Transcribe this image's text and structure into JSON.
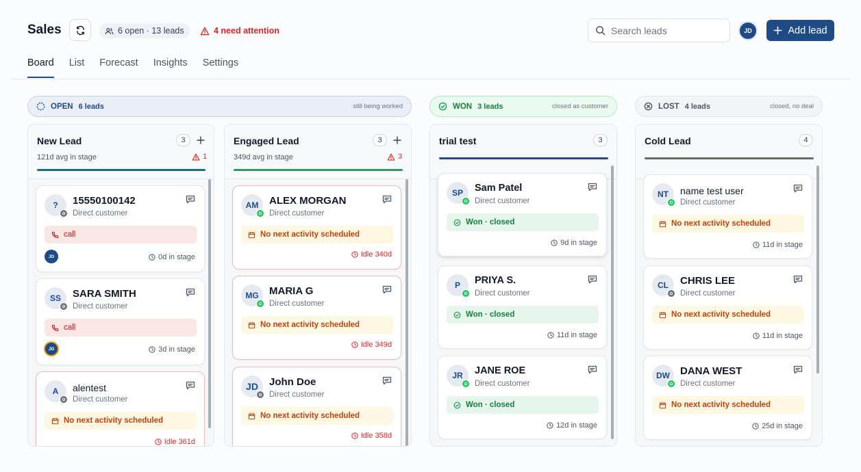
{
  "header": {
    "title": "Sales",
    "lead_count": "6 open · 13 leads",
    "attention": "4 need attention",
    "search_placeholder": "Search leads",
    "user_initials": "JD",
    "add_label": "Add lead"
  },
  "tabs": [
    "Board",
    "List",
    "Forecast",
    "Insights",
    "Settings"
  ],
  "groups": {
    "open": {
      "name": "OPEN",
      "count": "6 leads",
      "note": "still being worked"
    },
    "won": {
      "name": "WON",
      "count": "3 leads",
      "note": "closed as customer"
    },
    "lost": {
      "name": "LOST",
      "count": "4 leads",
      "note": "closed, no deal"
    }
  },
  "columns": {
    "new_lead": {
      "title": "New Lead",
      "count": "3",
      "avg": "121d avg in stage",
      "alert": "1",
      "cards": [
        {
          "initials": "?",
          "name": "15550100142",
          "sub": "Direct customer",
          "pill": "call",
          "owner": "JD",
          "foot": "0d in stage"
        },
        {
          "initials": "SS",
          "name": "SARA SMITH",
          "sub": "Direct customer",
          "pill": "call",
          "owner": "JD",
          "foot": "3d in stage"
        },
        {
          "initials": "A",
          "name": "alentest",
          "sub": "Direct customer",
          "pill": "No next activity scheduled",
          "foot": "Idle 361d"
        }
      ]
    },
    "engaged_lead": {
      "title": "Engaged Lead",
      "count": "3",
      "avg": "349d avg in stage",
      "alert": "3",
      "cards": [
        {
          "initials": "AM",
          "name": "ALEX MORGAN",
          "sub": "Direct customer",
          "pill": "No next activity scheduled",
          "foot": "Idle 340d"
        },
        {
          "initials": "MG",
          "name": "MARIA G",
          "sub": "Direct customer",
          "pill": "No next activity scheduled",
          "foot": "Idle 349d"
        },
        {
          "initials": "JD",
          "name": "John Doe",
          "sub": "Direct customer",
          "pill": "No next activity scheduled",
          "foot": "Idle 358d"
        }
      ]
    },
    "trial_test": {
      "title": "trial test",
      "count": "3",
      "cards": [
        {
          "initials": "SP",
          "name": "Sam Patel",
          "sub": "Direct customer",
          "pill": "Won · closed",
          "foot": "9d in stage"
        },
        {
          "initials": "P",
          "name": "PRIYA S.",
          "sub": "Direct customer",
          "pill": "Won · closed",
          "foot": "11d in stage"
        },
        {
          "initials": "JR",
          "name": "JANE ROE",
          "sub": "Direct customer",
          "pill": "Won · closed",
          "foot": "12d in stage"
        }
      ]
    },
    "cold_lead": {
      "title": "Cold Lead",
      "count": "4",
      "cards": [
        {
          "initials": "NT",
          "name": "name test user",
          "sub": "Direct customer",
          "pill": "No next activity scheduled",
          "foot": "11d in stage"
        },
        {
          "initials": "CL",
          "name": "CHRIS LEE",
          "sub": "Direct customer",
          "pill": "No next activity scheduled",
          "foot": "11d in stage"
        },
        {
          "initials": "DW",
          "name": "DANA WEST",
          "sub": "Direct customer",
          "pill": "No next activity scheduled",
          "foot": "25d in stage"
        }
      ]
    }
  },
  "colors": {
    "brand": "#1e4a86",
    "won": "#16a34a",
    "danger": "#dc2626",
    "warning": "#c2410c",
    "lost": "#6b6b63"
  }
}
